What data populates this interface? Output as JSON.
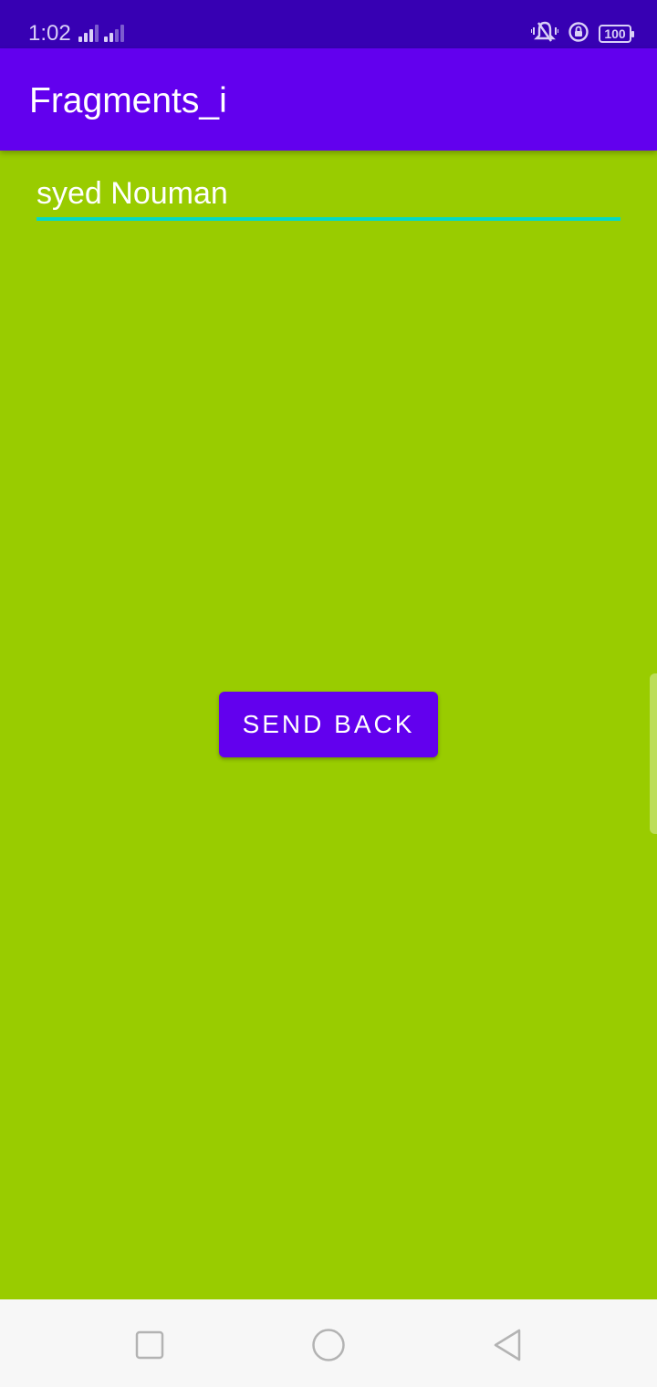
{
  "status_bar": {
    "time": "1:02",
    "battery_level": "100",
    "icons": [
      "signal-icon",
      "signal-icon",
      "vibrate-icon",
      "rotation-lock-icon",
      "battery-icon"
    ]
  },
  "app_bar": {
    "title": "Fragments_i",
    "color": "#6200ee"
  },
  "main": {
    "background_color": "#99cc00",
    "text_field": {
      "value": "syed Nouman",
      "underline_color": "#03dac5"
    },
    "send_button": {
      "label": "SEND BACK",
      "color": "#6200ee"
    }
  },
  "nav_bar": {
    "icons": [
      "recent-apps-icon",
      "home-icon",
      "back-icon"
    ]
  }
}
